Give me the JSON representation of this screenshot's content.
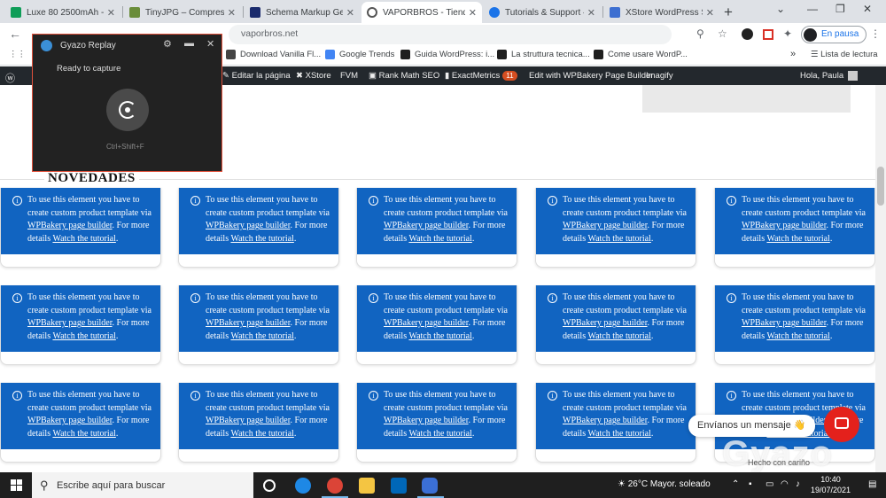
{
  "browser": {
    "tabs": [
      {
        "title": "Luxe 80 2500mAh - Va",
        "favicon_color": "#0f9d58"
      },
      {
        "title": "TinyJPG – Compress JP",
        "favicon_color": "#6a8d3a"
      },
      {
        "title": "Schema Markup Gene",
        "favicon_color": "#1a2b6d"
      },
      {
        "title": "VAPORBROS - Tienda",
        "favicon_color": "#555555"
      },
      {
        "title": "Tutorials & Support «",
        "favicon_color": "#1a73e8"
      },
      {
        "title": "XStore WordPress Sup",
        "favicon_color": "#3d6fd1"
      }
    ],
    "profile_label": "En pausa",
    "address_text": "vaporbros.net",
    "bookmarks": [
      {
        "label": "Download Vanilla Fl...",
        "color": "#444444"
      },
      {
        "label": "Google Trends",
        "color": "#4285f4"
      },
      {
        "label": "Guida WordPress: i...",
        "color": "#1f1f1f"
      },
      {
        "label": "La struttura tecnica...",
        "color": "#1f1f1f"
      },
      {
        "label": "Come usare WordP...",
        "color": "#1f1f1f"
      }
    ],
    "bookmarks_list_label": "Lista de lectura"
  },
  "adminbar": {
    "items": [
      "Editar la página",
      "XStore",
      "FVM",
      "Rank Math SEO",
      "ExactMetrics",
      "Edit with WPBakery Page Builder",
      "Imagify"
    ],
    "exactmetrics_badge": "11",
    "greeting": "Hola, Paula"
  },
  "page": {
    "section_title": "NOVEDADES",
    "card_text_before": "To use this element you have to create custom product template via ",
    "card_link1": "WPBakery page builder",
    "card_text_mid": ". For more details ",
    "card_link2": "Watch the tutorial",
    "card_text_end": ".",
    "card_color": "#1164c1"
  },
  "chat": {
    "bubble_text": "Envíanos un mensaje 👋",
    "powered_text": "Hecho con cariño"
  },
  "gyazo": {
    "title": "Gyazo Replay",
    "status": "Ready to capture",
    "shortcut": "Ctrl+Shift+F",
    "watermark": "Gyazo"
  },
  "taskbar": {
    "search_placeholder": "Escribe aquí para buscar",
    "weather": "26°C  Mayor. soleado",
    "time": "10:40",
    "date": "19/07/2021"
  }
}
